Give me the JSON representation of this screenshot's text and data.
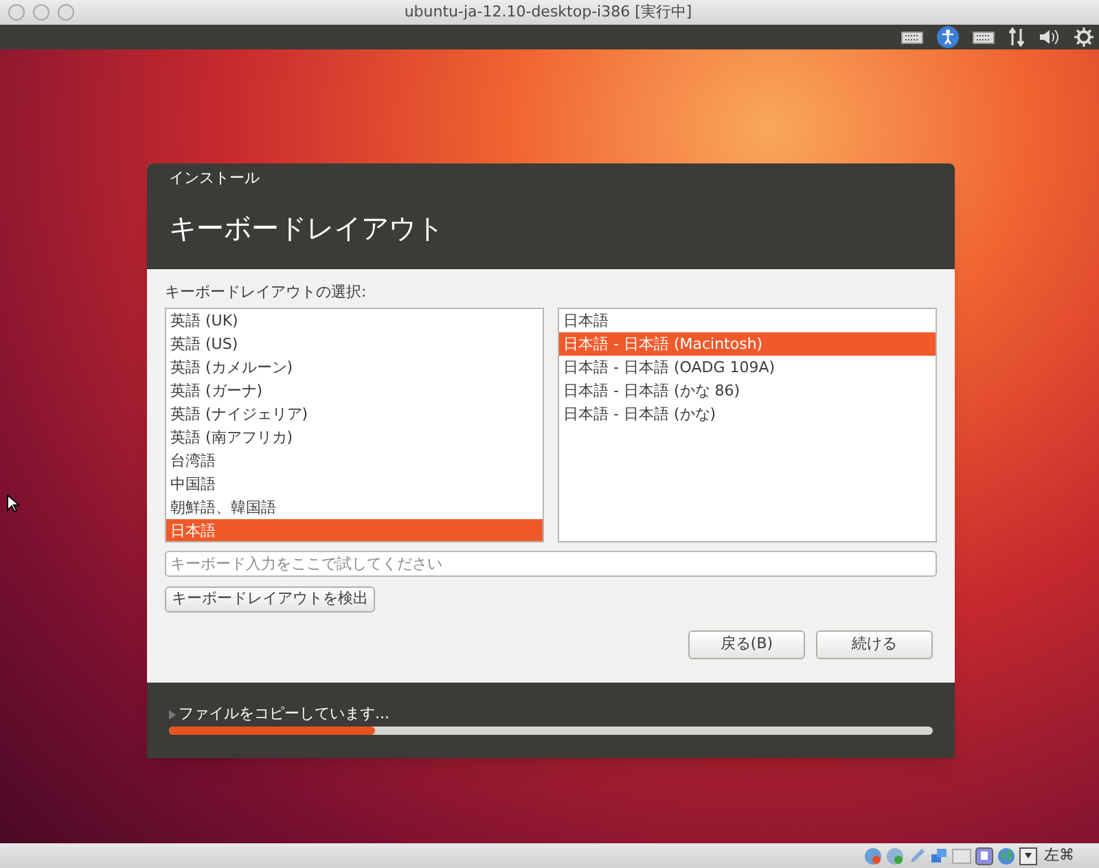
{
  "window": {
    "title": "ubuntu-ja-12.10-desktop-i386 [実行中]"
  },
  "installer": {
    "caption": "インストール",
    "heading": "キーボードレイアウト",
    "list_label": "キーボードレイアウトの選択:",
    "languages": [
      {
        "label": "英語 (UK)",
        "selected": false
      },
      {
        "label": "英語 (US)",
        "selected": false
      },
      {
        "label": "英語 (カメルーン)",
        "selected": false
      },
      {
        "label": "英語 (ガーナ)",
        "selected": false
      },
      {
        "label": "英語 (ナイジェリア)",
        "selected": false
      },
      {
        "label": "英語 (南アフリカ)",
        "selected": false
      },
      {
        "label": "台湾語",
        "selected": false
      },
      {
        "label": "中国語",
        "selected": false
      },
      {
        "label": "朝鮮語、韓国語",
        "selected": false
      },
      {
        "label": "日本語",
        "selected": true
      }
    ],
    "variants": [
      {
        "label": "日本語",
        "selected": false
      },
      {
        "label": "日本語 - 日本語 (Macintosh)",
        "selected": true
      },
      {
        "label": "日本語 - 日本語 (OADG 109A)",
        "selected": false
      },
      {
        "label": "日本語 - 日本語 (かな 86)",
        "selected": false
      },
      {
        "label": "日本語 - 日本語 (かな)",
        "selected": false
      }
    ],
    "test_field": {
      "placeholder": "キーボード入力をここで試してください"
    },
    "detect_button": "キーボードレイアウトを検出",
    "buttons": [
      "戻る(B)",
      "続ける"
    ],
    "progress": {
      "text": "ファイルをコピーしています...",
      "level": 0.27
    }
  },
  "status_bar": {
    "host_key": "左⌘"
  }
}
